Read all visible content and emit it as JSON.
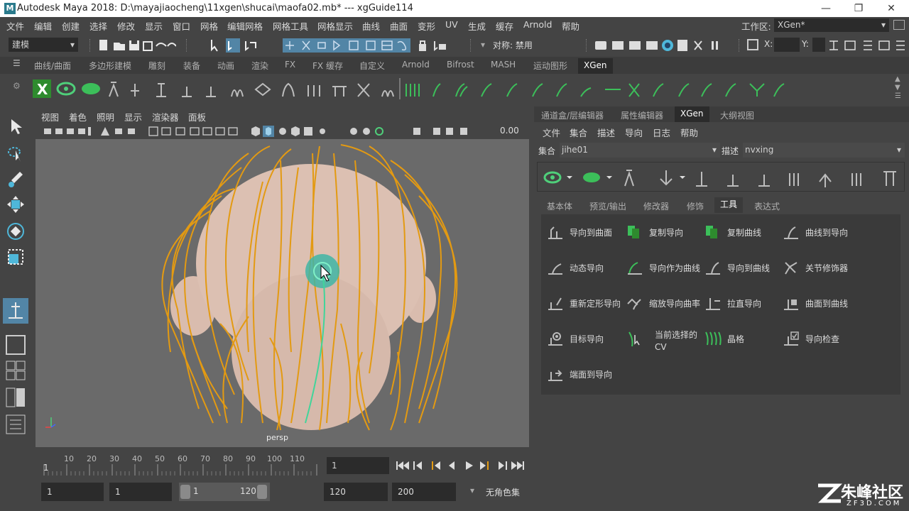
{
  "titlebar": {
    "title": "Autodesk Maya 2018: D:\\mayajiaocheng\\11xgen\\shucai\\maofa02.mb*   ---   xgGuide114",
    "app_icon": "M"
  },
  "menubar": {
    "items": [
      "文件",
      "编辑",
      "创建",
      "选择",
      "修改",
      "显示",
      "窗口",
      "网格",
      "编辑网格",
      "网格工具",
      "网格显示",
      "曲线",
      "曲面",
      "变形",
      "UV",
      "生成",
      "缓存",
      "Arnold",
      "帮助"
    ],
    "workspace_label": "工作区:",
    "workspace_value": "XGen*"
  },
  "statusline": {
    "mode_value": "建模",
    "symmetry_label": "对称: 禁用",
    "x_label": "X:",
    "y_label": "Y:"
  },
  "shelf": {
    "tabs": [
      "曲线/曲面",
      "多边形建模",
      "雕刻",
      "装备",
      "动画",
      "渲染",
      "FX",
      "FX 缓存",
      "自定义",
      "Arnold",
      "Bifrost",
      "MASH",
      "运动图形",
      "XGen"
    ],
    "active_tab": "XGen"
  },
  "viewport": {
    "menu": [
      "视图",
      "着色",
      "照明",
      "显示",
      "渲染器",
      "面板"
    ],
    "exposure_value": "0.00",
    "camera_label": "persp",
    "colors": {
      "hair": "#e39a12",
      "guide_selected": "#40d59a",
      "head": "#dcc0b2",
      "background": "#6a6a6a"
    }
  },
  "rightpanel": {
    "tabs": [
      "通道盒/层编辑器",
      "属性编辑器",
      "XGen",
      "大纲视图"
    ],
    "active_tab": "XGen",
    "menu": [
      "文件",
      "集合",
      "描述",
      "导向",
      "日志",
      "帮助"
    ],
    "collection_label": "集合",
    "collection_value": "jihe01",
    "description_label": "描述",
    "description_value": "nvxing",
    "subtabs": [
      "基本体",
      "预览/输出",
      "修改器",
      "修饰",
      "工具",
      "表达式"
    ],
    "active_subtab": "工具",
    "tools": [
      [
        "导向到曲面",
        "复制导向",
        "复制曲线",
        "曲线到导向"
      ],
      [
        "动态导向",
        "导向作为曲线",
        "导向到曲线",
        "关节修饰器"
      ],
      [
        "重新定形导向",
        "缩放导向曲率",
        "拉直导向",
        "曲面到曲线"
      ],
      [
        "目标导向",
        "当前选择的 CV",
        "晶格",
        "导向检查"
      ],
      [
        "端面到导向"
      ]
    ],
    "tool_multiline": {
      "line1": "当前选择的",
      "line2": "CV"
    }
  },
  "timeline": {
    "ticks": [
      "10",
      "20",
      "30",
      "40",
      "50",
      "60",
      "70",
      "80",
      "90",
      "100",
      "110"
    ],
    "start_tick": "1",
    "current_frame": "1"
  },
  "rangebar": {
    "start": "1",
    "playback_start": "1",
    "slider_left": "1",
    "slider_right": "120",
    "playback_end": "120",
    "end": "200",
    "character_set": "无角色集"
  },
  "watermark": {
    "brand": "朱峰社区",
    "url": "ZF3D.COM"
  }
}
